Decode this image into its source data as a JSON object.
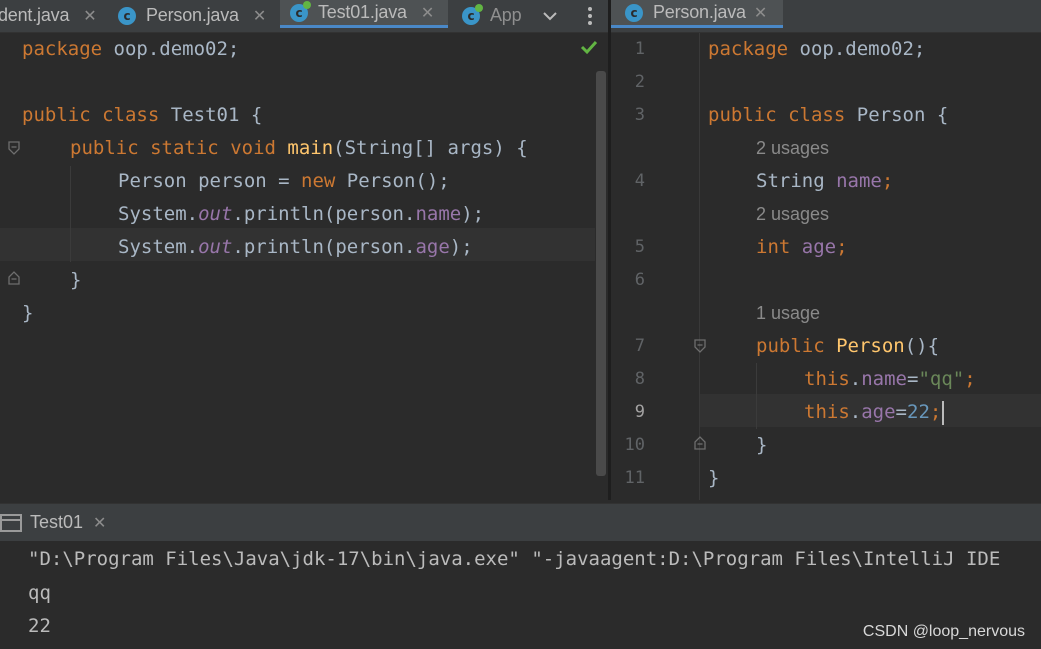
{
  "left_tabs": [
    {
      "label": "dent.java",
      "icon": "none",
      "active": false
    },
    {
      "label": "Person.java",
      "icon": "class-icon",
      "active": false
    },
    {
      "label": "Test01.java",
      "icon": "runnable-class-icon",
      "active": true
    },
    {
      "label": "App",
      "icon": "runnable-class-icon",
      "active": false
    }
  ],
  "right_tabs": [
    {
      "label": "Person.java",
      "icon": "class-icon",
      "active": true
    }
  ],
  "left_code": {
    "line1": [
      "package",
      "oop.demo02;"
    ],
    "line3": [
      "public",
      "class",
      "Test01 {"
    ],
    "line4": [
      "public",
      "static",
      "void",
      "main",
      "(String[] args) {"
    ],
    "line5": [
      "Person person = ",
      "new",
      " Person();"
    ],
    "line6": [
      "System.",
      "out",
      ".println(person.",
      "name",
      ");"
    ],
    "line7": [
      "System.",
      "out",
      ".println(person.",
      "age",
      ");"
    ],
    "line8": "}",
    "line9": "}"
  },
  "right_code": {
    "line_numbers": [
      "1",
      "2",
      "3",
      "4",
      "5",
      "6",
      "7",
      "8",
      "9",
      "10",
      "11"
    ],
    "line1": [
      "package",
      "oop.demo02;"
    ],
    "line3": [
      "public",
      "class",
      "Person {"
    ],
    "hint_name": "2 usages",
    "line4": [
      "String ",
      "name",
      ";"
    ],
    "hint_age": "2 usages",
    "line5": [
      "int",
      " ",
      "age",
      ";"
    ],
    "hint_ctor": "1 usage",
    "line7": [
      "public",
      "Person",
      "(){"
    ],
    "line8": [
      "this",
      ".",
      "name",
      "=",
      "\"qq\"",
      ";"
    ],
    "line9": [
      "this",
      ".",
      "age",
      "=",
      "22",
      ";"
    ],
    "line10": "}",
    "line11": "}"
  },
  "run_panel": {
    "tab_label": "Test01",
    "console_lines": [
      "\"D:\\Program Files\\Java\\jdk-17\\bin\\java.exe\" \"-javaagent:D:\\Program Files\\IntelliJ IDE",
      "qq",
      "22"
    ]
  },
  "watermark": "CSDN @loop_nervous",
  "colors": {
    "keyword": "#cc7832",
    "method": "#ffc66d",
    "field": "#9876aa",
    "string": "#6a8759",
    "number": "#6897bb",
    "text": "#a9b7c6",
    "background": "#2b2b2b",
    "tab_accent": "#4a88c7"
  }
}
